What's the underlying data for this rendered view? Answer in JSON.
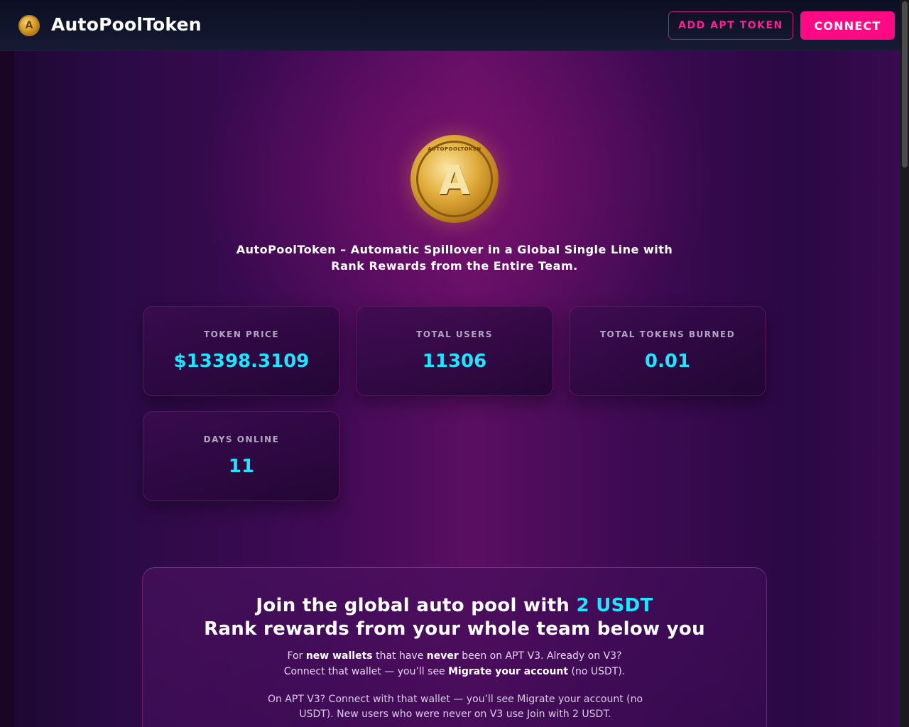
{
  "header": {
    "brand_name": "AutoPoolToken",
    "add_token_label": "ADD APT TOKEN",
    "connect_label": "CONNECT"
  },
  "hero": {
    "coin_text": "AUTOPOOLTOKEN",
    "coin_letter": "A",
    "tagline_line1": "AutoPoolToken – Automatic Spillover in a Global Single Line with",
    "tagline_line2": "Rank Rewards from the Entire Team."
  },
  "stats": [
    {
      "label": "TOKEN PRICE",
      "value": "$13398.3109"
    },
    {
      "label": "TOTAL USERS",
      "value": "11306"
    },
    {
      "label": "TOTAL TOKENS BURNED",
      "value": "0.01"
    },
    {
      "label": "DAYS ONLINE",
      "value": "11"
    }
  ],
  "join": {
    "title_prefix": "Join the global auto pool with ",
    "title_accent": "2 USDT",
    "title_line2": "Rank rewards from your whole team below you",
    "desc_line1_a": "For ",
    "desc_line1_b": "new wallets",
    "desc_line1_c": " that have ",
    "desc_line1_d": "never",
    "desc_line1_e": " been on APT V3. Already on V3?",
    "desc_line2_a": "Connect that wallet — you’ll see ",
    "desc_line2_b": "Migrate your account",
    "desc_line2_c": " (no USDT).",
    "note": "On APT V3? Connect with that wallet — you’ll see Migrate your account (no USDT). New users who were never on V3 use Join with 2 USDT."
  },
  "colors": {
    "accent_cyan": "#1ee6ff",
    "accent_pink": "#ff0a84",
    "background": "#3f0a55"
  }
}
